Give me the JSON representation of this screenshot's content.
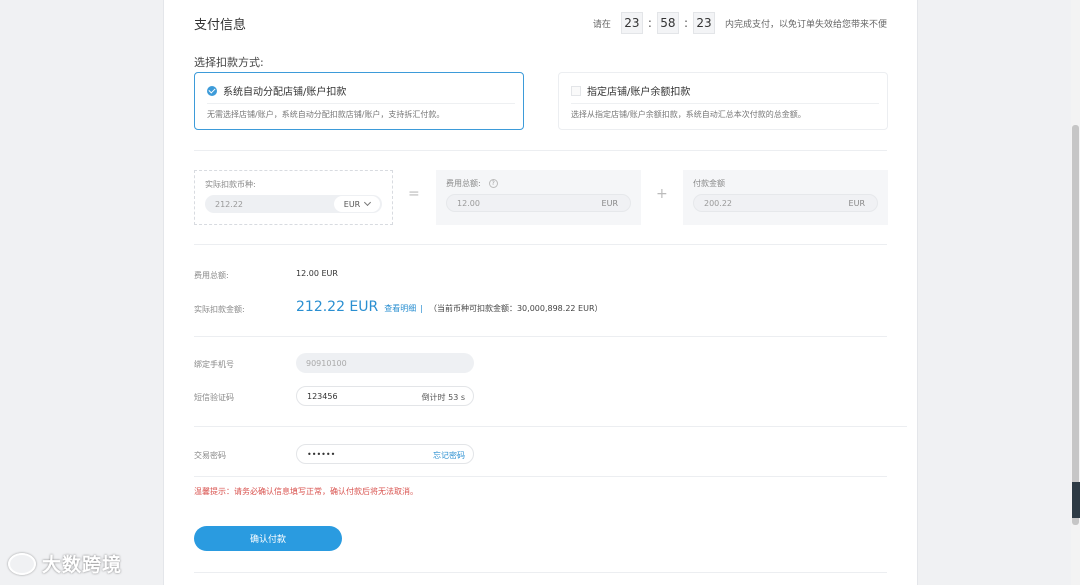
{
  "header": {
    "title": "支付信息",
    "countdown_prefix": "请在",
    "hours": "23",
    "minutes": "58",
    "seconds": "23",
    "countdown_suffix": "内完成支付，以免订单失效给您带来不便"
  },
  "deduction": {
    "label": "选择扣款方式:",
    "options": [
      {
        "title": "系统自动分配店铺/账户扣款",
        "desc": "无需选择店铺/账户，系统自动分配扣款店铺/账户，支持拆汇付款。",
        "selected": true
      },
      {
        "title": "指定店铺/账户余额扣款",
        "desc": "选择从指定店铺/账户余额扣款，系统自动汇总本次付款的总金额。",
        "selected": false
      }
    ]
  },
  "calc": {
    "actual_label": "实际扣款币种:",
    "actual_value": "212.22",
    "actual_currency": "EUR",
    "equals": "=",
    "fee_label": "费用总额:",
    "fee_value": "12.00",
    "fee_currency": "EUR",
    "plus": "+",
    "pay_label": "付款金额",
    "pay_value": "200.22",
    "pay_currency": "EUR"
  },
  "summary": {
    "fee_total_label": "费用总额:",
    "fee_total_value": "12.00 EUR",
    "actual_label": "实际扣款金额:",
    "actual_value": "212.22 EUR",
    "detail_link": "查看明细",
    "separator": "|",
    "balance_note": "（当前币种可扣款金额：30,000,898.22 EUR）"
  },
  "form": {
    "phone_label": "绑定手机号",
    "phone_value": "90910100",
    "sms_label": "短信验证码",
    "sms_value": "123456",
    "sms_countdown": "倒计时 53 s",
    "pwd_label": "交易密码",
    "pwd_value": "••••••",
    "forgot_link": "忘记密码"
  },
  "warning": "温馨提示：请务必确认信息填写正常，确认付款后将无法取消。",
  "confirm_button": "确认付款",
  "watermark": "大数跨境",
  "colors": {
    "accent": "#2a9be0",
    "warning": "#d9534f"
  }
}
